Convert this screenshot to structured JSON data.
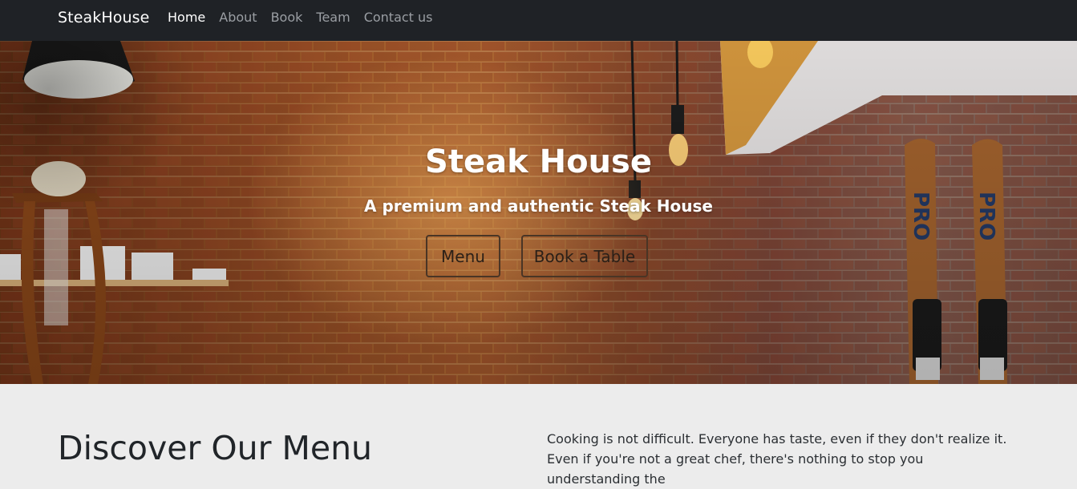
{
  "navbar": {
    "brand": "SteakHouse",
    "links": [
      {
        "label": "Home",
        "active": true
      },
      {
        "label": "About",
        "active": false
      },
      {
        "label": "Book",
        "active": false
      },
      {
        "label": "Team",
        "active": false
      },
      {
        "label": "Contact us",
        "active": false
      }
    ]
  },
  "hero": {
    "title": "Steak House",
    "subtitle": "A premium and authentic Steak House",
    "buttons": {
      "menu": "Menu",
      "book": "Book a Table"
    }
  },
  "intro": {
    "title": "Discover Our Menu",
    "text": "Cooking is not difficult. Everyone has taste, even if they don't realize it. Even if you're not a great chef, there's nothing to stop you understanding the"
  },
  "colors": {
    "navbar_bg": "#1f2226",
    "nav_active": "#ffffff",
    "nav_inactive": "#9a9ea3",
    "section_bg": "#ececec"
  }
}
